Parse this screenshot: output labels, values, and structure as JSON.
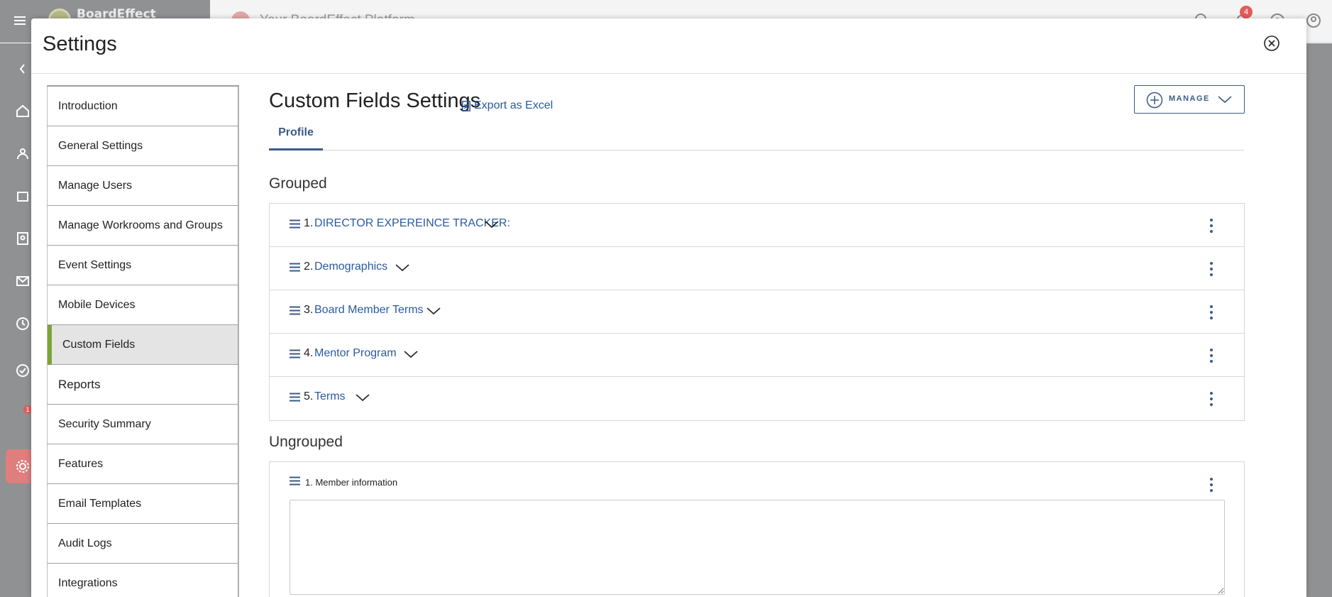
{
  "app": {
    "logo_text": "BoardEffect",
    "platform_title": "Your BoardEffect Platform",
    "notification_count": "4",
    "nav_badge_count": "1"
  },
  "modal": {
    "title": "Settings"
  },
  "settings_menu": {
    "items": [
      {
        "label": "Introduction"
      },
      {
        "label": "General Settings"
      },
      {
        "label": "Manage Users"
      },
      {
        "label": "Manage Workrooms and Groups"
      },
      {
        "label": "Event Settings"
      },
      {
        "label": "Mobile Devices"
      },
      {
        "label": "Custom Fields"
      },
      {
        "label": "Reports"
      },
      {
        "label": "Security Summary"
      },
      {
        "label": "Features"
      },
      {
        "label": "Email Templates"
      },
      {
        "label": "Audit Logs"
      },
      {
        "label": "Integrations"
      }
    ],
    "active_item": "Custom Fields"
  },
  "content": {
    "page_title": "Custom Fields Settings",
    "export_label": "Export as Excel",
    "manage_label": "MANAGE",
    "tabs": [
      {
        "label": "Profile"
      }
    ],
    "grouped_heading": "Grouped",
    "grouped": [
      {
        "num": "1.",
        "label": "DIRECTOR EXPEREINCE TRACKER:"
      },
      {
        "num": "2.",
        "label": "Demographics"
      },
      {
        "num": "3.",
        "label": "Board Member Terms"
      },
      {
        "num": "4.",
        "label": "Mentor Program"
      },
      {
        "num": "5.",
        "label": "Terms"
      }
    ],
    "ungrouped_heading": "Ungrouped",
    "ungrouped": [
      {
        "label": "1. Member information",
        "value": ""
      }
    ]
  },
  "colors": {
    "accent": "#3c5a86",
    "link": "#2a5aa0",
    "active_marker": "#7ba535",
    "notification": "#e45b5b"
  }
}
